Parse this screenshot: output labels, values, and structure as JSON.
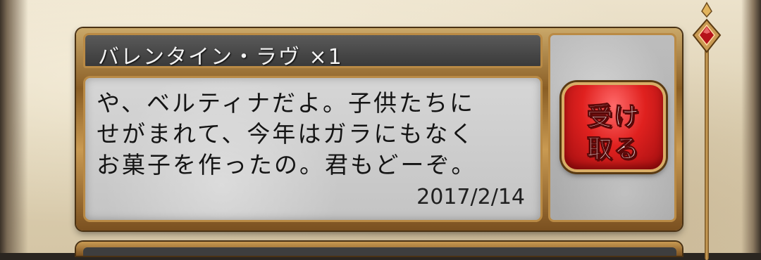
{
  "gift": {
    "title": "バレンタイン・ラヴ ×1",
    "message_lines": [
      "や、ベルティナだよ。子供たちに",
      "せがまれて、今年はガラにもなく",
      "お菓子を作ったの。君もどーぞ。"
    ],
    "date": "2017/2/14"
  },
  "receive_button": {
    "label_top": "受け",
    "label_bottom": "取る",
    "color": "#d8201e"
  },
  "colors": {
    "frame_gold": "#b98a45",
    "title_bar": "#4a4a4a",
    "message_panel": "#cfcfcf",
    "parchment": "#e2d6ba"
  },
  "icons": {
    "scroll_handle": "diamond-gem-icon"
  }
}
